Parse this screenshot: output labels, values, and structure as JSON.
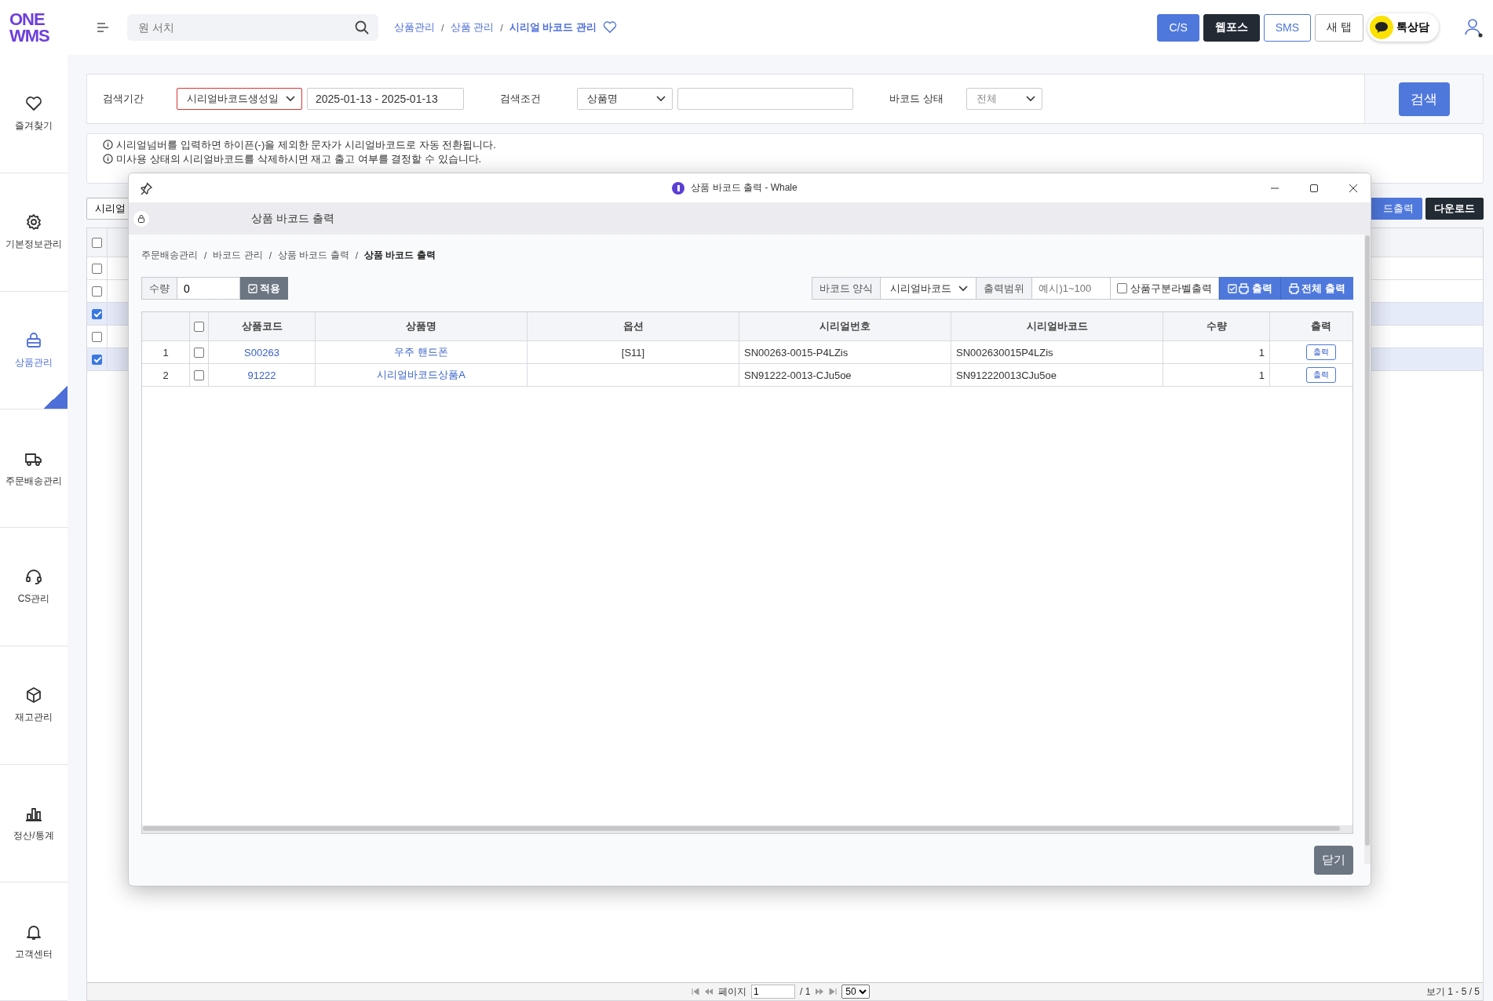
{
  "header": {
    "logo": [
      "ONE",
      "WMS"
    ],
    "search": {
      "placeholder": "원 서치"
    },
    "breadcrumb": [
      {
        "label": "상품관리",
        "current": false
      },
      {
        "separator": "/",
        "label": "상품 관리",
        "current": false
      },
      {
        "separator": "/",
        "label": "시리얼 바코드 관리",
        "current": true
      }
    ],
    "buttons": [
      {
        "label": "C/S",
        "kind": "primary"
      },
      {
        "label": "웹포스",
        "kind": "dark"
      },
      {
        "label": "SMS",
        "kind": "outline"
      },
      {
        "label": "새 탭",
        "kind": "plain"
      }
    ],
    "chat_button": "톡상담"
  },
  "sidebar": {
    "items": [
      {
        "label": "즐겨찾기",
        "selected": false
      },
      {
        "label": "기본정보관리",
        "selected": false
      },
      {
        "label": "상품관리",
        "selected": true
      },
      {
        "label": "주문배송관리",
        "selected": false
      },
      {
        "label": "CS관리",
        "selected": false
      },
      {
        "label": "재고관리",
        "selected": false
      },
      {
        "label": "정산/통계",
        "selected": false
      },
      {
        "label": "고객센터",
        "selected": false
      }
    ]
  },
  "search_panel": {
    "period_label": "검색기간",
    "period_select": "시리얼바코드생성일",
    "date_range": "2025-01-13 - 2025-01-13",
    "condition_label": "검색조건",
    "condition_select": "상품명",
    "status_label": "바코드 상태",
    "status_select": "전체",
    "search_button": "검색"
  },
  "notices": [
    "시리얼넘버를 입력하면 하이픈(-)을 제외한 문자가 시리얼바코드로 자동 전환됩니다.",
    "미사용 상태의 시리얼바코드를 삭제하시면 재고 출고 여부를 결정할 수 있습니다."
  ],
  "toolbar": {
    "left_button": "시리얼",
    "right_buttons": [
      {
        "label": "드출력",
        "kind": "primary"
      },
      {
        "label": "다운로드",
        "kind": "dark"
      }
    ]
  },
  "table": {
    "header_checked": false,
    "rows": [
      {
        "checked": false
      },
      {
        "checked": false
      },
      {
        "checked": true
      },
      {
        "checked": false
      },
      {
        "checked": true
      }
    ]
  },
  "pagination": {
    "page_label": "페이지",
    "page": "1",
    "total": "/ 1",
    "page_size": "50",
    "summary": "보기 1 - 5 / 5"
  },
  "popup": {
    "title": "상품 바코드 출력 - Whale",
    "address": "상품 바코드 출력",
    "breadcrumb": [
      {
        "label": "주문배송관리",
        "current": false
      },
      {
        "separator": "/",
        "label": "바코드 관리",
        "current": false
      },
      {
        "separator": "/",
        "label": "상품 바코드 출력",
        "current": false
      },
      {
        "separator": "/",
        "label": "상품 바코드 출력",
        "current": true
      }
    ],
    "qty_label": "수량",
    "qty_value": "0",
    "apply_button": "적용",
    "format_label": "바코드 양식",
    "format_select": "시리얼바코드",
    "range_label": "출력범위",
    "range_placeholder": "예시)1~100",
    "label_checkbox": {
      "label": "상품구분라벨출력",
      "checked": false
    },
    "print_button": "출력",
    "print_all_button": "전체 출력",
    "table": {
      "header_checked": false,
      "columns": [
        "상품코드",
        "상품명",
        "옵션",
        "시리얼번호",
        "시리얼바코드",
        "수량",
        "출력"
      ],
      "rows": [
        {
          "no": "1",
          "checked": false,
          "code": "S00263",
          "name": "우주 핸드폰",
          "option": "[S11]",
          "serial": "SN00263-0015-P4LZis",
          "barcode": "SN002630015P4LZis",
          "qty": "1",
          "print": "출력"
        },
        {
          "no": "2",
          "checked": false,
          "code": "91222",
          "name": "시리얼바코드상품A",
          "option": "",
          "serial": "SN91222-0013-CJu5oe",
          "barcode": "SN912220013CJu5oe",
          "qty": "1",
          "print": "출력"
        }
      ]
    },
    "close_button": "닫기"
  }
}
